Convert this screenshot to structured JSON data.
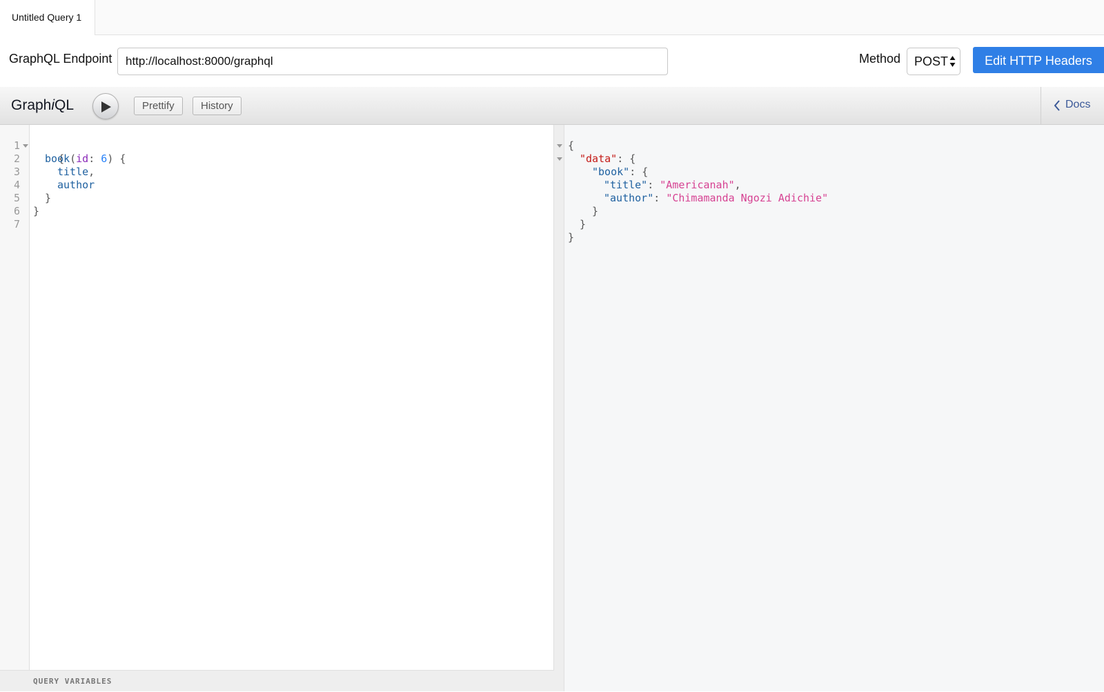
{
  "tabs": [
    {
      "label": "Untitled Query 1"
    }
  ],
  "endpoint": {
    "label": "GraphQL Endpoint",
    "value": "http://localhost:8000/graphql"
  },
  "method": {
    "label": "Method",
    "selected": "POST"
  },
  "headers_button": "Edit HTTP Headers",
  "toolbar": {
    "brand_pre": "Graph",
    "brand_i": "i",
    "brand_post": "QL",
    "prettify": "Prettify",
    "history": "History",
    "docs": "Docs"
  },
  "query": {
    "line_numbers": [
      "1",
      "2",
      "3",
      "4",
      "5",
      "6",
      "7"
    ],
    "open_brace": "{",
    "field": "book",
    "paren_open": "(",
    "arg_name": "id",
    "colon": ": ",
    "arg_value": "6",
    "paren_close": ") {",
    "field_title": "title",
    "comma": ",",
    "field_author": "author",
    "inner_close": "}",
    "outer_close": "}"
  },
  "variables_label": "QUERY VARIABLES",
  "result": {
    "open": "{",
    "data_key": "\"data\"",
    "data_sep": ": {",
    "book_key": "\"book\"",
    "book_sep": ": {",
    "title_key": "\"title\"",
    "colon": ": ",
    "title_value": "\"Americanah\"",
    "comma": ",",
    "author_key": "\"author\"",
    "author_value": "\"Chimamanda Ngozi Adichie\"",
    "close_book": "}",
    "close_data": "}",
    "close_root": "}"
  },
  "colors": {
    "accent": "#2f7fe6",
    "docs_link": "#3b5998",
    "string": "#d64292",
    "json_key": "#c41a16",
    "field": "#1f61a0"
  }
}
